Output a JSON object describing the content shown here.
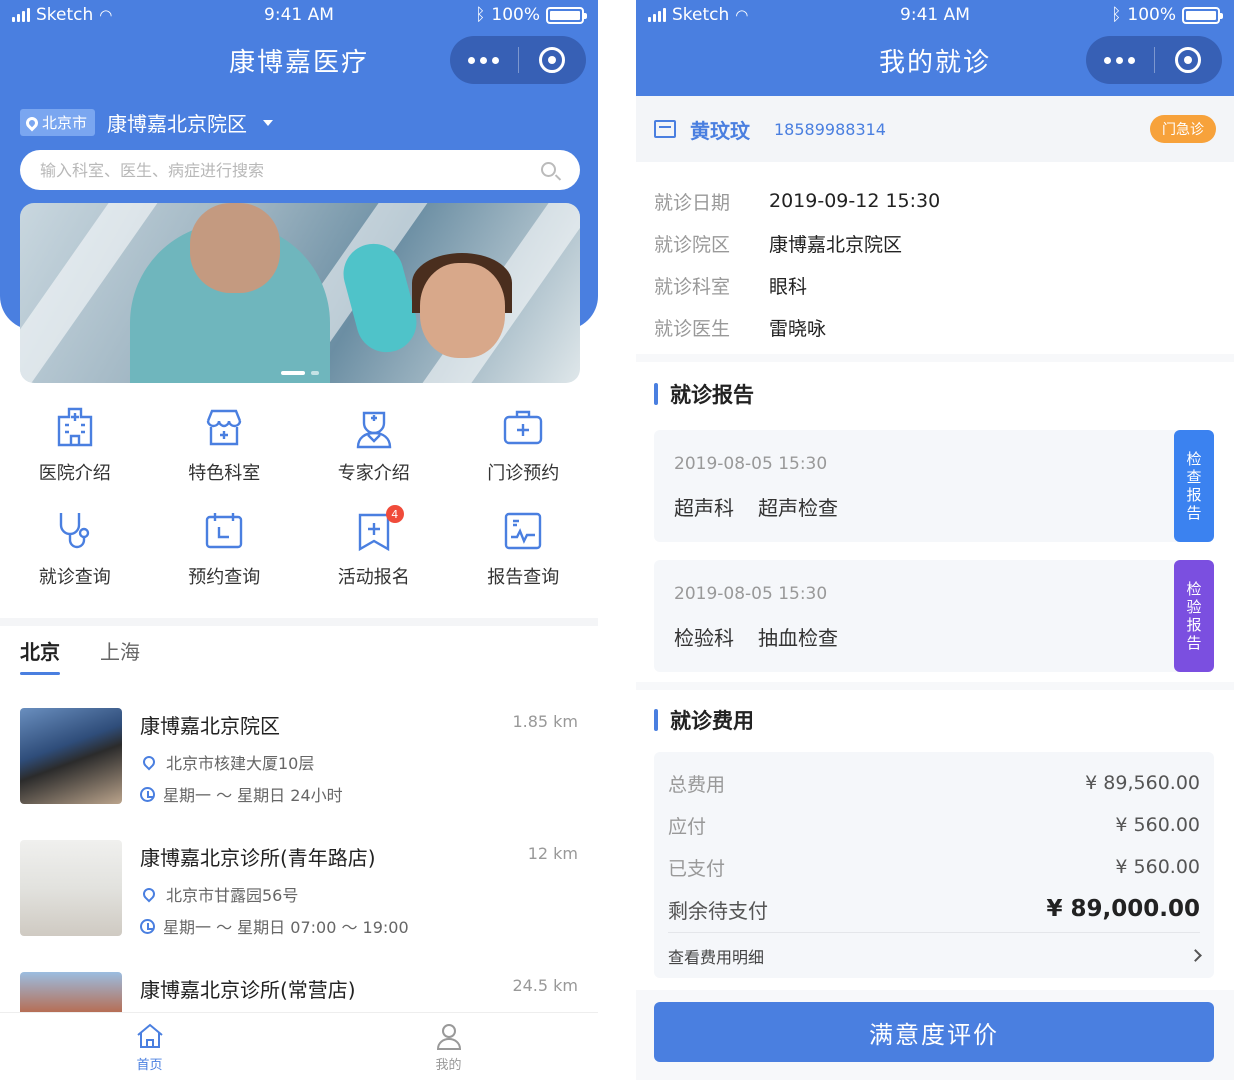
{
  "status": {
    "carrier": "Sketch",
    "time": "9:41 AM",
    "battery": "100%"
  },
  "home": {
    "title": "康博嘉医疗",
    "city": "北京市",
    "campus": "康博嘉北京院区",
    "search_placeholder": "输入科室、医生、病症进行搜索",
    "menu": [
      {
        "label": "医院介绍",
        "icon": "hospital-icon"
      },
      {
        "label": "特色科室",
        "icon": "department-icon"
      },
      {
        "label": "专家介绍",
        "icon": "doctor-icon"
      },
      {
        "label": "门诊预约",
        "icon": "medical-kit-icon"
      },
      {
        "label": "就诊查询",
        "icon": "stethoscope-icon"
      },
      {
        "label": "预约查询",
        "icon": "calendar-icon"
      },
      {
        "label": "活动报名",
        "icon": "event-icon",
        "badge": "4"
      },
      {
        "label": "报告查询",
        "icon": "report-icon"
      }
    ],
    "tabs": [
      "北京",
      "上海"
    ],
    "hospitals": [
      {
        "name": "康博嘉北京院区",
        "distance": "1.85 km",
        "address": "北京市核建大厦10层",
        "hours": "星期一 ～ 星期日  24小时"
      },
      {
        "name": "康博嘉北京诊所(青年路店)",
        "distance": "12 km",
        "address": "北京市甘露园56号",
        "hours": "星期一 ～ 星期日  07:00 ～ 19:00"
      },
      {
        "name": "康博嘉北京诊所(常营店)",
        "distance": "24.5 km",
        "address": "",
        "hours": ""
      }
    ],
    "tabbar": [
      "首页",
      "我的"
    ]
  },
  "visit": {
    "title": "我的就诊",
    "patient_name": "黄玟玟",
    "phone": "18589988314",
    "visit_type": "门急诊",
    "details": [
      {
        "k": "就诊日期",
        "v": "2019-09-12 15:30"
      },
      {
        "k": "就诊院区",
        "v": "康博嘉北京院区"
      },
      {
        "k": "就诊科室",
        "v": "眼科"
      },
      {
        "k": "就诊医生",
        "v": "雷晓咏"
      }
    ],
    "reports_title": "就诊报告",
    "reports": [
      {
        "time": "2019-08-05 15:30",
        "dept": "超声科",
        "item": "超声检查",
        "tag": "检查报告",
        "color": "#3b82f0"
      },
      {
        "time": "2019-08-05 15:30",
        "dept": "检验科",
        "item": "抽血检查",
        "tag": "检验报告",
        "color": "#7b4fe0"
      }
    ],
    "fees_title": "就诊费用",
    "fees": [
      {
        "k": "总费用",
        "v": "¥ 89,560.00"
      },
      {
        "k": "应付",
        "v": "¥ 560.00"
      },
      {
        "k": "已支付",
        "v": "¥ 560.00"
      }
    ],
    "fee_total": {
      "k": "剩余待支付",
      "v": "¥ 89,000.00"
    },
    "fee_detail_link": "查看费用明细",
    "action_button": "满意度评价"
  },
  "colors": {
    "primary": "#4a7fe0",
    "orange": "#f7a23b",
    "badge": "#f04b3a"
  }
}
